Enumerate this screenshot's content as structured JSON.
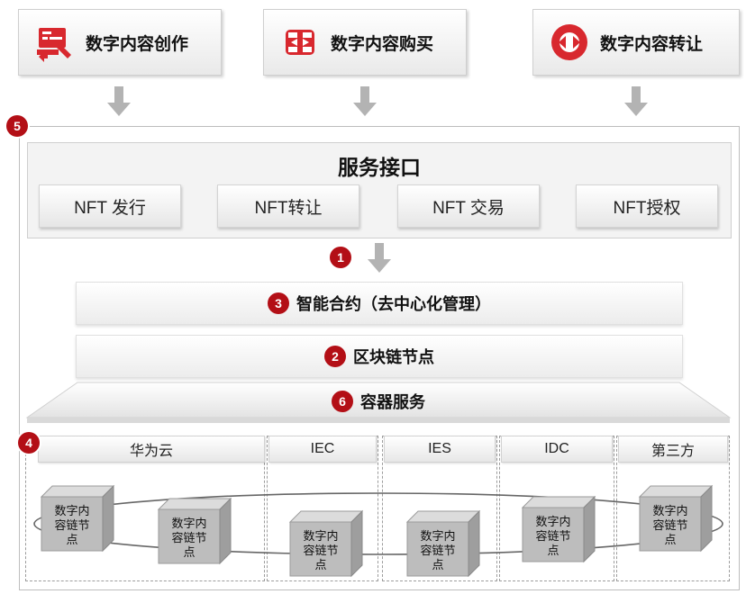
{
  "top_cards": [
    {
      "label": "数字内容创作",
      "icon": "content-creation-icon"
    },
    {
      "label": "数字内容购买",
      "icon": "content-purchase-icon"
    },
    {
      "label": "数字内容转让",
      "icon": "content-transfer-icon"
    }
  ],
  "frame_badge": "5",
  "service": {
    "title": "服务接口",
    "buttons": [
      "NFT 发行",
      "NFT转让",
      "NFT 交易",
      "NFT授权"
    ]
  },
  "flow_badge": "1",
  "layers": [
    {
      "badge": "3",
      "label": "智能合约（去中心化管理）"
    },
    {
      "badge": "2",
      "label": "区块链节点"
    },
    {
      "badge": "6",
      "label": "容器服务"
    }
  ],
  "clouds_badge": "4",
  "clouds": [
    "华为云",
    "IEC",
    "IES",
    "IDC",
    "第三方"
  ],
  "node_label": {
    "line1": "数字内",
    "line2": "容链节",
    "line3": "点"
  },
  "colors": {
    "accent_red": "#b30f16",
    "icon_red": "#d8282e",
    "arrow_gray": "#b3b3b3",
    "cube_gray": "#bdbdbd"
  }
}
